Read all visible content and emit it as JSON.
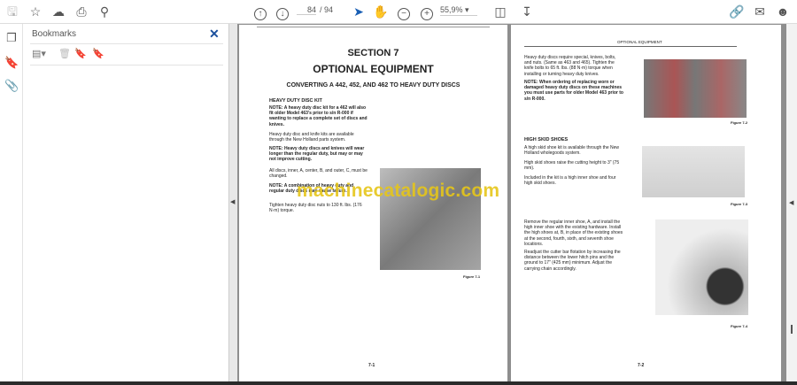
{
  "toolbar": {
    "current_page": "84",
    "total_pages": "/ 94",
    "zoom": "55,9%",
    "icons": [
      "save-icon",
      "star-icon",
      "cloud-upload-icon",
      "print-icon",
      "zoom-search-icon",
      "page-up-icon",
      "page-down-icon",
      "select-arrow-icon",
      "hand-icon",
      "zoom-out-icon",
      "zoom-in-icon",
      "fit-page-icon",
      "scroll-mode-icon",
      "share-link-icon",
      "mail-icon",
      "account-icon"
    ]
  },
  "bookmarks": {
    "title": "Bookmarks"
  },
  "left_page": {
    "section": "SECTION 7",
    "title": "OPTIONAL EQUIPMENT",
    "subtitle": "CONVERTING A 442, 452, AND 462 TO HEAVY DUTY DISCS",
    "heading": "HEAVY DUTY DISC KIT",
    "p1": "NOTE: A heavy duty disc kit for a 462 will also fit older Model 463's prior to s/n R-000 if wanting to replace a complete set of discs and knives.",
    "p2": "Heavy duty disc and knife kits are available through the New Holland parts system.",
    "p3": "NOTE: Heavy duty discs and knives will wear longer than the regular duty, but may or may not improve cutting.",
    "p4": "All discs, inner, A, center, B, and outer, C, must be changed.",
    "p5": "NOTE: A combination of heavy duty and regular duty discs may cause failure.",
    "p6": "Tighten heavy duty disc nuts to 130 ft. lbs. (176 N·m) torque.",
    "figure": "Figure 7-1",
    "page_num": "7-1"
  },
  "right_page": {
    "header": "OPTIONAL EQUIPMENT",
    "p1": "Heavy duty discs require special, knives, bolts, and nuts. (Same as 463 and 465). Tighten the knife bolts to 65 ft. lbs. (88 N·m) torque when installing or turning heavy duty knives.",
    "p2": "NOTE: When ordering of replacing worn or damaged heavy duty discs on these machines you must use parts for older Model 463 prior to s/n R-000.",
    "fig2": "Figure 7-2",
    "heading": "HIGH SKID SHOES",
    "p3": "A high skid shoe kit is available through the New Holland wholegoods system.",
    "p4": "High skid shoes raise the cutting height to 3\" (75 mm).",
    "p5": "Included in the kit is a high inner shoe and four high skid shoes.",
    "fig3": "Figure 7-3",
    "p6": "Remove the regular inner shoe, A, and install the high inner shoe with the existing hardware. Install the high shoes at, B, in place of the existing shoes at the second, fourth, sixth, and seventh shoe locations.",
    "p7": "Readjust the cutter bar flotation by increasing the distance between the lower hitch pins and the ground to 17\" (425 mm) minimum. Adjust the carrying chain accordingly.",
    "fig4": "Figure 7-4",
    "page_num": "7-2"
  },
  "watermark": "machinecatalogic.com"
}
